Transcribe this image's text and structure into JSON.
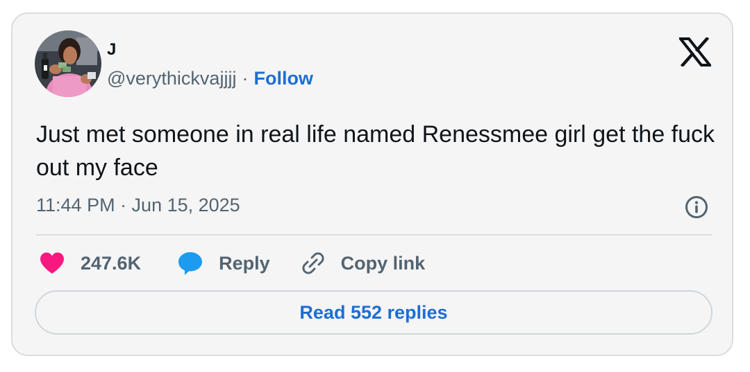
{
  "author": {
    "display_name": "J",
    "handle": "@verythickvajjjj",
    "separator": "·",
    "follow_label": "Follow"
  },
  "tweet": {
    "text": "Just met someone in real life named Renessmee girl get the fuck out my face",
    "timestamp": "11:44 PM · Jun 15, 2025"
  },
  "actions": {
    "likes": "247.6K",
    "reply_label": "Reply",
    "copy_link_label": "Copy link"
  },
  "read_replies_label": "Read 552 replies",
  "icons": {
    "brand": "x-logo-icon",
    "like": "heart-icon",
    "reply": "speech-bubble-icon",
    "copy": "link-icon",
    "info": "info-icon"
  },
  "colors": {
    "accent": "#1d6ed3",
    "like": "#f91880",
    "reply": "#1d9bf0",
    "muted": "#536471",
    "text": "#0f1419",
    "card_bg": "#f5f5f5",
    "border": "#d9dde1"
  }
}
